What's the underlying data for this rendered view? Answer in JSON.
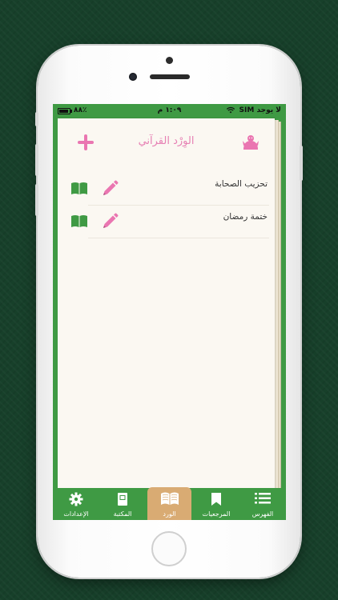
{
  "status_bar": {
    "carrier": "لا يوجد SIM",
    "time": "١:٠٩ م",
    "battery": "٨٨٪",
    "battery_level": 0.88
  },
  "header": {
    "title": "الوِرْد القرآني",
    "add_icon": "plus-icon",
    "left_icon": "praying-figure-icon"
  },
  "wird_list": [
    {
      "label": "تحزيب الصحابة",
      "edit_icon": "pencil-icon",
      "open_icon": "open-book-icon"
    },
    {
      "label": "ختمة رمضان",
      "edit_icon": "pencil-icon",
      "open_icon": "open-book-icon"
    }
  ],
  "tabs": [
    {
      "label": "الإعدادات",
      "icon": "gear-icon"
    },
    {
      "label": "المكتبة",
      "icon": "library-book-icon"
    },
    {
      "label": "الورد",
      "icon": "open-book-icon",
      "active": true
    },
    {
      "label": "المرجعيات",
      "icon": "bookmark-icon"
    },
    {
      "label": "الفهرس",
      "icon": "list-icon"
    }
  ],
  "colors": {
    "green": "#3f9a44",
    "pink": "#ea76b1",
    "active_tab": "#d9ab73",
    "page": "#fbf8f2"
  }
}
